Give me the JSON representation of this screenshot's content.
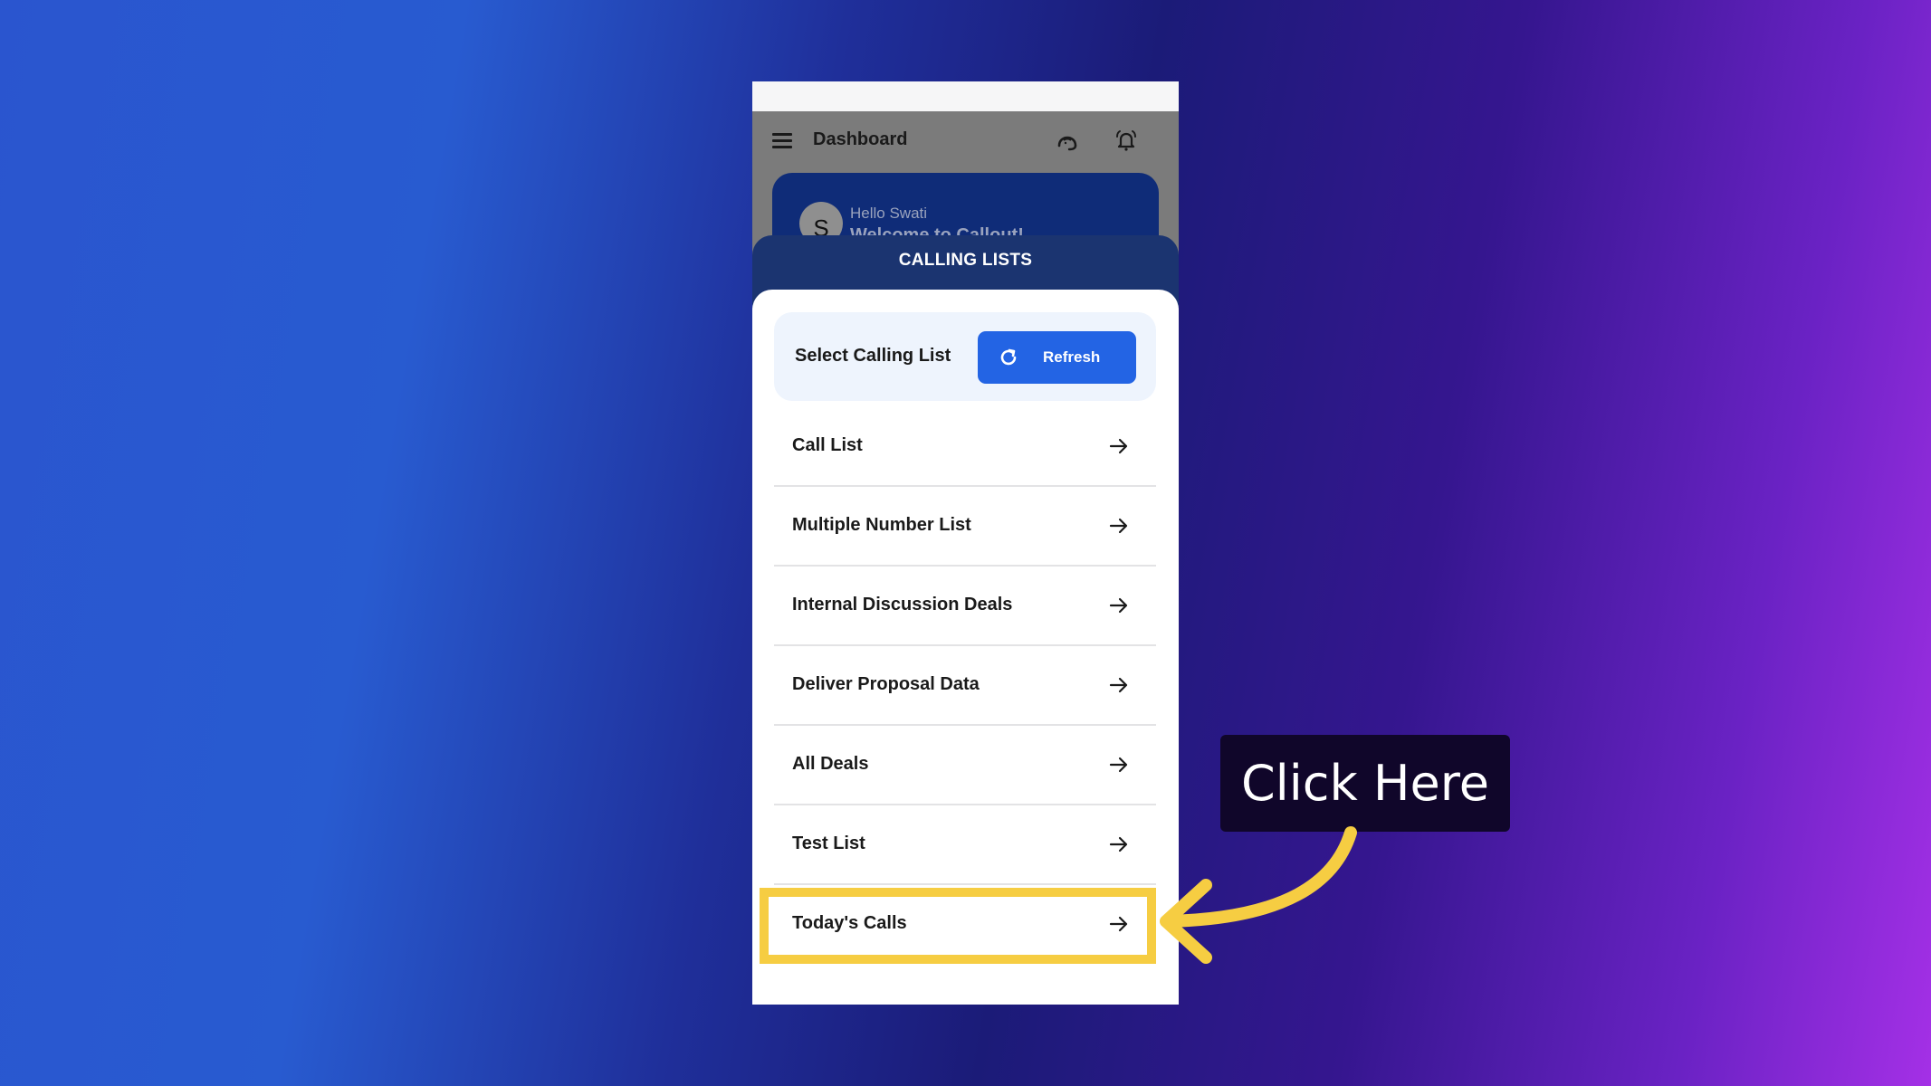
{
  "app": {
    "header": {
      "title": "Dashboard",
      "menu_icon": "hamburger-menu-icon",
      "support_icon": "headset-support-icon",
      "notification_icon": "bell-ringing-icon"
    },
    "welcome_card": {
      "avatar_initial": "S",
      "greeting": "Hello Swati",
      "welcome_text": "Welcome to Callout!"
    },
    "sheet": {
      "title": "CALLING LISTS",
      "select_label": "Select Calling List",
      "refresh": {
        "label": "Refresh",
        "icon": "refresh-icon"
      },
      "items": [
        {
          "label": "Call List",
          "icon": "arrow-right-icon"
        },
        {
          "label": "Multiple Number List",
          "icon": "arrow-right-icon"
        },
        {
          "label": "Internal Discussion Deals",
          "icon": "arrow-right-icon"
        },
        {
          "label": "Deliver Proposal Data",
          "icon": "arrow-right-icon"
        },
        {
          "label": "All Deals",
          "icon": "arrow-right-icon"
        },
        {
          "label": "Test List",
          "icon": "arrow-right-icon"
        },
        {
          "label": "Today's Calls",
          "icon": "arrow-right-icon",
          "highlighted": true
        }
      ]
    }
  },
  "annotation": {
    "callout_text": "Click Here",
    "highlight_color": "#f6cd42",
    "callout_bg": "#10062a"
  },
  "colors": {
    "primary_button": "#2364e4",
    "sheet_header": "#1b3470",
    "welcome_card": "#0f2c78"
  }
}
